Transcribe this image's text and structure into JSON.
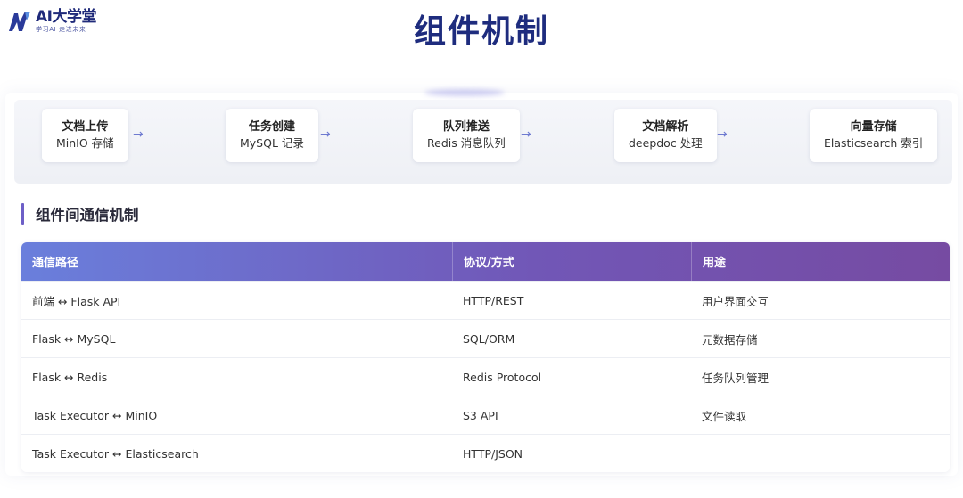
{
  "brand": {
    "name": "AI大学堂",
    "slogan": "学习AI·走进未来"
  },
  "page": {
    "title": "组件机制"
  },
  "flow": {
    "arrow": "→",
    "steps": [
      {
        "title": "文档上传",
        "desc": "MinIO 存储"
      },
      {
        "title": "任务创建",
        "desc": "MySQL 记录"
      },
      {
        "title": "队列推送",
        "desc": "Redis 消息队列"
      },
      {
        "title": "文档解析",
        "desc": "deepdoc 处理"
      },
      {
        "title": "向量存储",
        "desc": "Elasticsearch 索引"
      }
    ]
  },
  "section": {
    "title": "组件间通信机制"
  },
  "table": {
    "headers": [
      "通信路径",
      "协议/方式",
      "用途"
    ],
    "rows": [
      [
        "前端 ↔ Flask API",
        "HTTP/REST",
        "用户界面交互"
      ],
      [
        "Flask ↔ MySQL",
        "SQL/ORM",
        "元数据存储"
      ],
      [
        "Flask ↔ Redis",
        "Redis Protocol",
        "任务队列管理"
      ],
      [
        "Task Executor ↔ MinIO",
        "S3 API",
        "文件读取"
      ],
      [
        "Task Executor ↔ Elasticsearch",
        "HTTP/JSON",
        ""
      ]
    ]
  },
  "colors": {
    "title": "#1e2c7e",
    "accent": "#6d5fc7",
    "header_gradient_start": "#6a7fdc",
    "header_gradient_end": "#764ba2"
  }
}
